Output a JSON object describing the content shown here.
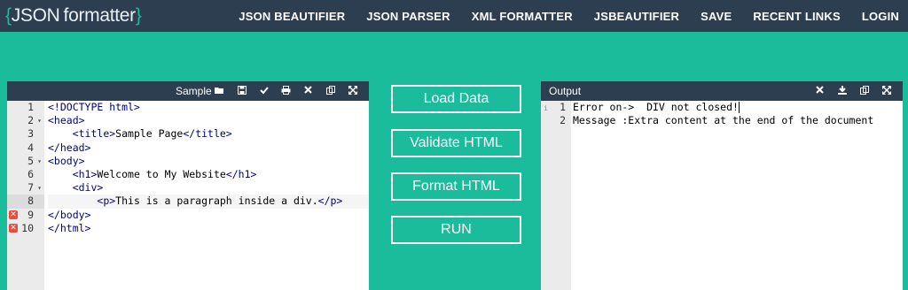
{
  "header": {
    "logo_open": "{",
    "logo_json": "JSON",
    "logo_text": "formatter",
    "logo_close": "}",
    "nav": [
      "JSON BEAUTIFIER",
      "JSON PARSER",
      "XML FORMATTER",
      "JSBEAUTIFIER",
      "SAVE",
      "RECENT LINKS",
      "LOGIN"
    ]
  },
  "editor": {
    "title": "Sample",
    "tool_icons": [
      "folder-open-icon",
      "save-icon",
      "check-icon",
      "print-icon",
      "close-icon",
      "copy-icon",
      "fullscreen-icon"
    ],
    "line_numbers": [
      "1",
      "2",
      "3",
      "4",
      "5",
      "6",
      "7",
      "8",
      "9",
      "10"
    ],
    "lines": [
      "<!DOCTYPE html>",
      "<head>",
      "    <title>Sample Page</title>",
      "</head>",
      "<body>",
      "    <h1>Welcome to My Website</h1>",
      "    <div>",
      "        <p>This is a paragraph inside a div.</p>",
      "</body>",
      "</html>"
    ],
    "folded_lines": [
      2,
      5,
      7
    ],
    "error_lines": [
      9,
      10
    ],
    "active_line": 8
  },
  "buttons": {
    "load": "Load Data",
    "validate": "Validate HTML",
    "format": "Format HTML",
    "run": "RUN"
  },
  "output": {
    "title": "Output",
    "tool_icons": [
      "close-icon",
      "download-icon",
      "copy-icon",
      "fullscreen-icon"
    ],
    "line_numbers": [
      "1",
      "2"
    ],
    "lines": [
      "Error on->  DIV not closed!",
      "Message :Extra content at the end of the document"
    ]
  },
  "colors": {
    "background": "#1abc9c",
    "header": "#2c3e50",
    "tag": "#000088",
    "error": "#e74c3c"
  }
}
